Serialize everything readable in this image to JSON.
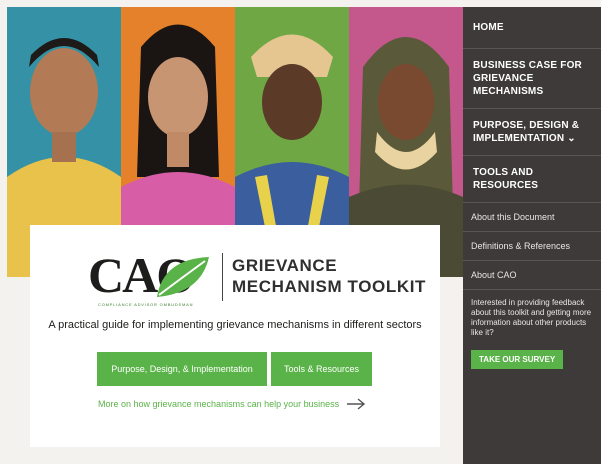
{
  "sidebar": {
    "main_items": [
      {
        "label": "Home"
      },
      {
        "label": "Business Case for Grievance Mechanisms"
      },
      {
        "label": "Purpose, Design & Implementation ⌄"
      },
      {
        "label": "Tools and Resources"
      }
    ],
    "sub_items": [
      {
        "label": "About this Document"
      },
      {
        "label": "Definitions & References"
      },
      {
        "label": "About CAO"
      }
    ],
    "feedback_note": "Interested in providing feedback about this toolkit and getting more information about other products like it?",
    "survey_button": "Take our survey"
  },
  "logo": {
    "text": "CAO",
    "tagline": "COMPLIANCE ADVISOR OMBUDSMAN"
  },
  "content": {
    "title": "Grievance Mechanism Toolkit",
    "subtitle": "A practical guide for implementing grievance mechanisms in different sectors",
    "buttons": {
      "purpose": "Purpose, Design, & Implementation",
      "tools": "Tools & Resources"
    },
    "more_link": "More on how grievance mechanisms can help your business"
  },
  "colors": {
    "accent_green": "#5ab348",
    "sidebar_bg": "#3d3a39"
  }
}
